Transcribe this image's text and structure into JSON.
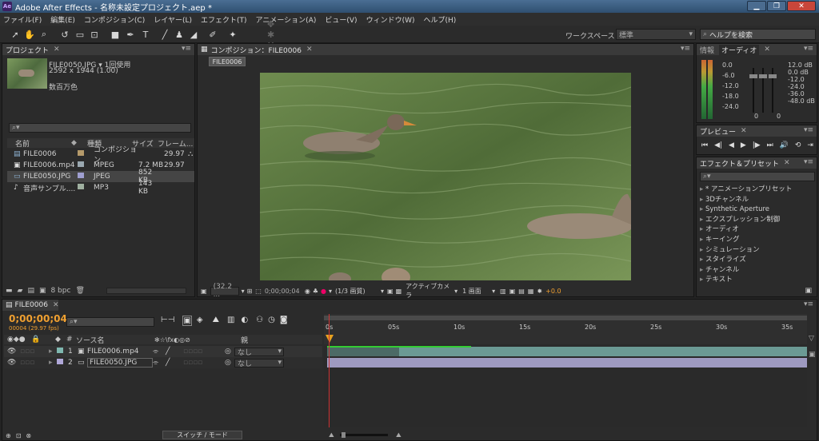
{
  "window": {
    "title": "Adobe After Effects - 名称未設定プロジェクト.aep *",
    "app_icon": "Ae",
    "minimize": "▁",
    "maximize": "❐",
    "close": "✕"
  },
  "menu": [
    "ファイル(F)",
    "編集(E)",
    "コンポジション(C)",
    "レイヤー(L)",
    "エフェクト(T)",
    "アニメーション(A)",
    "ビュー(V)",
    "ウィンドウ(W)",
    "ヘルプ(H)"
  ],
  "toolbar": {
    "workspace_label": "ワークスペース：",
    "workspace_value": "標準",
    "help_placeholder": "ヘルプを検索"
  },
  "project": {
    "tab": "プロジェクト",
    "selected_name": "FILE0050.JPG ▾ 1回使用",
    "selected_dims": "2592 x 1944 (1.00)",
    "selected_color": "数百万色",
    "columns": [
      "名前",
      "種類",
      "サイズ",
      "フレーム..."
    ],
    "items": [
      {
        "name": "FILE0006",
        "type": "コンポジション",
        "size": "",
        "fps": "29.97",
        "color": "#b59a6a"
      },
      {
        "name": "FILE0006.mp4",
        "type": "MPEG",
        "size": "7.2 MB",
        "fps": "29.97",
        "color": "#9aa8b0"
      },
      {
        "name": "FILE0050.JPG",
        "type": "JPEG",
        "size": "852 KB",
        "fps": "",
        "color": "#9f9fd0"
      },
      {
        "name": "音声サンプル....",
        "type": "MP3",
        "size": "143 KB",
        "fps": "",
        "color": "#9fb0a0"
      }
    ],
    "bpc": "8 bpc"
  },
  "comp": {
    "tab": "コンポジション：FILE0006",
    "chip": "FILE0006",
    "zoom": "(32.2 ...",
    "timecode": "0;00;00;04",
    "resolution": "(1/3 画質)",
    "camera": "アクティブカメラ",
    "views": "1 画面",
    "exposure": "+0.0"
  },
  "info": {
    "tab_info": "情報",
    "tab_audio": "オーディオ",
    "db_left": [
      "0.0",
      "-6.0",
      "-12.0",
      "-18.0",
      "-24.0"
    ],
    "db_right": [
      "12.0 dB",
      "0.0 dB",
      "-12.0",
      "-24.0",
      "-36.0",
      "-48.0 dB"
    ],
    "zero_a": "0",
    "zero_b": "0"
  },
  "preview": {
    "tab": "プレビュー",
    "controls": [
      "⏮",
      "◀|",
      "◀",
      "▶",
      "|▶",
      "⏭",
      "🔊",
      "⟲",
      "⇥"
    ]
  },
  "effects": {
    "tab": "エフェクト＆プリセット",
    "items": [
      "* アニメーションプリセット",
      "3Dチャンネル",
      "Synthetic Aperture",
      "エクスプレッション制御",
      "オーディオ",
      "キーイング",
      "シミュレーション",
      "スタイライズ",
      "チャンネル",
      "テキスト"
    ]
  },
  "timeline": {
    "tab": "FILE0006",
    "timecode": "0;00;00;04",
    "fps_info": "00004 (29.97 fps)",
    "col_source": "ソース名",
    "col_parent": "親",
    "layers": [
      {
        "num": "1",
        "name": "FILE0006.mp4",
        "parent": "なし",
        "color": "#7fb8b0"
      },
      {
        "num": "2",
        "name": "FILE0050.JPG",
        "parent": "なし",
        "color": "#b0a8d8"
      }
    ],
    "ruler": [
      "0s",
      "05s",
      "10s",
      "15s",
      "20s",
      "25s",
      "30s",
      "35s"
    ],
    "switch_mode": "スイッチ / モード"
  }
}
